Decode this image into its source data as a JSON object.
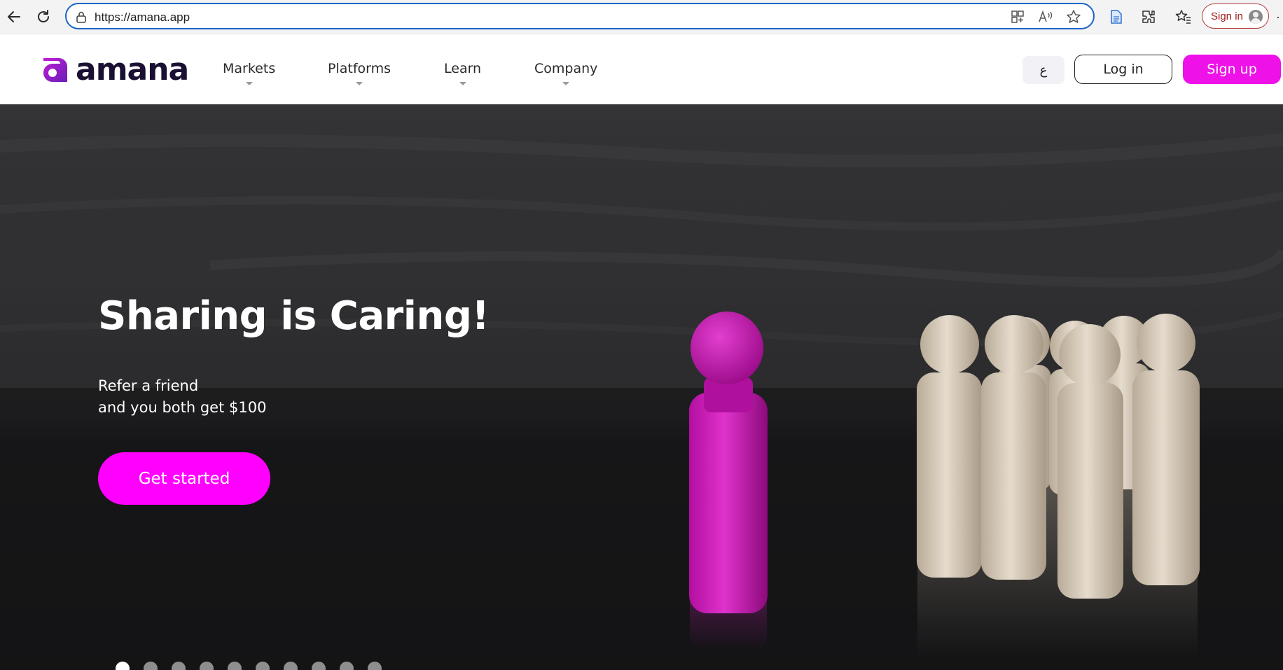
{
  "browser": {
    "url": "https://amana.app",
    "signin_label": "Sign in",
    "icons": [
      "back-icon",
      "refresh-icon",
      "lock-icon",
      "apps-icon",
      "read-aloud-icon",
      "favorite-star-icon",
      "document-icon",
      "extensions-icon",
      "favorites-icon",
      "profile-icon",
      "more-icon"
    ]
  },
  "header": {
    "logo_text": "amana",
    "nav": [
      {
        "label": "Markets"
      },
      {
        "label": "Platforms"
      },
      {
        "label": "Learn"
      },
      {
        "label": "Company"
      }
    ],
    "lang_label": "ع",
    "login_label": "Log in",
    "signup_label": "Sign up"
  },
  "hero": {
    "title": "Sharing is Caring!",
    "subtitle_line1": "Refer a friend",
    "subtitle_line2": "and you both get $100",
    "cta_label": "Get started",
    "slide_count": 10,
    "active_slide": 1
  },
  "colors": {
    "brand_magenta": "#ff00ff",
    "signup_magenta": "#ee11e8",
    "logo_dark": "#1b1033",
    "address_border": "#1a64c8"
  }
}
